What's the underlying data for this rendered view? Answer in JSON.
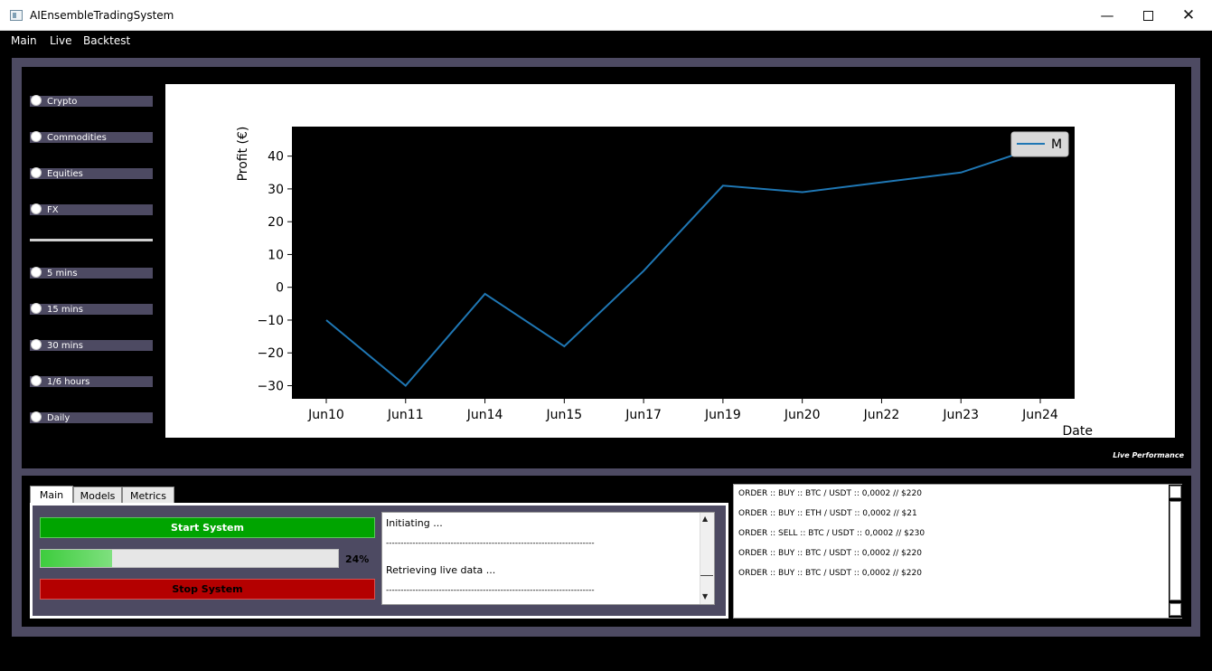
{
  "window": {
    "title": "AIEnsembleTradingSystem"
  },
  "menu": {
    "items": [
      "Main",
      "Live",
      "Backtest"
    ]
  },
  "markets": [
    "Crypto",
    "Commodities",
    "Equities",
    "FX"
  ],
  "timeframes": [
    "5 mins",
    "15 mins",
    "30 mins",
    "1/6 hours",
    "Daily"
  ],
  "panel_caption": "Live Performance",
  "tabs": [
    "Main",
    "Models",
    "Metrics"
  ],
  "controls": {
    "start_label": "Start System",
    "stop_label": "Stop System",
    "progress": 24,
    "progress_text": "24%"
  },
  "log": [
    "Initiating ...",
    "-----------------------------------------------------------------------",
    "Retrieving live data ...",
    "-----------------------------------------------------------------------"
  ],
  "orders": [
    "ORDER :: BUY :: BTC / USDT :: 0,0002 // $220",
    "ORDER :: BUY :: ETH / USDT :: 0,0002 // $21",
    "ORDER :: SELL :: BTC / USDT :: 0,0002 // $230",
    "ORDER :: BUY :: BTC / USDT :: 0,0002 // $220",
    "ORDER :: BUY :: BTC / USDT :: 0,0002 // $220"
  ],
  "colors": {
    "frame": "#4d4a62",
    "start": "#00a400",
    "stop": "#b40000",
    "line": "#1f77b4",
    "plot_bg": "#000000"
  },
  "chart_data": {
    "type": "line",
    "categories": [
      "Jun10",
      "Jun11",
      "Jun14",
      "Jun15",
      "Jun17",
      "Jun19",
      "Jun20",
      "Jun22",
      "Jun23",
      "Jun24"
    ],
    "series": [
      {
        "name": "M",
        "values": [
          -10,
          -30,
          -2,
          -18,
          5,
          31,
          29,
          32,
          35,
          43
        ]
      }
    ],
    "xlabel": "Date",
    "ylabel": "Profit (€)",
    "yticks": [
      -30,
      -20,
      -10,
      0,
      10,
      20,
      30,
      40
    ],
    "ylim": [
      -34,
      49
    ],
    "legend": "top-right",
    "grid": false
  }
}
